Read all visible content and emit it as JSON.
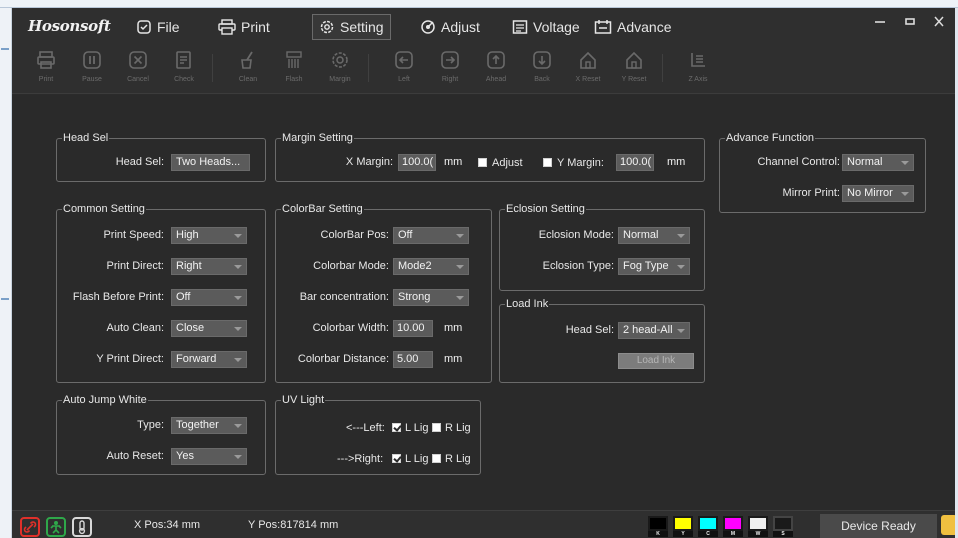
{
  "title_bar": {
    "logo": "Hosonsoft",
    "menu": [
      {
        "label": "File",
        "icon": "file-check-icon"
      },
      {
        "label": "Print",
        "icon": "printer-icon"
      },
      {
        "label": "Setting",
        "icon": "gear-icon",
        "active": true
      },
      {
        "label": "Adjust",
        "icon": "adjust-icon"
      },
      {
        "label": "Voltage",
        "icon": "voltage-icon"
      },
      {
        "label": "Advance",
        "icon": "advance-icon"
      }
    ]
  },
  "toolbar": {
    "buttons": [
      {
        "label": "Print",
        "icon": "print-icon"
      },
      {
        "label": "Pause",
        "icon": "pause-icon"
      },
      {
        "label": "Cancel",
        "icon": "cancel-icon"
      },
      {
        "label": "Check",
        "icon": "check-icon"
      },
      {
        "label": "Clean",
        "icon": "clean-icon"
      },
      {
        "label": "Flash",
        "icon": "flash-icon"
      },
      {
        "label": "Margin",
        "icon": "margin-icon"
      },
      {
        "label": "Left",
        "icon": "arrow-left-icon"
      },
      {
        "label": "Right",
        "icon": "arrow-right-icon"
      },
      {
        "label": "Ahead",
        "icon": "arrow-up-icon"
      },
      {
        "label": "Back",
        "icon": "arrow-down-icon"
      },
      {
        "label": "X Reset",
        "icon": "home-icon"
      },
      {
        "label": "Y Reset",
        "icon": "home-icon"
      },
      {
        "label": "Z Axis",
        "icon": "z-axis-icon"
      }
    ]
  },
  "head_sel_group": {
    "legend": "Head Sel",
    "label": "Head Sel:",
    "value": "Two Heads..."
  },
  "margin_group": {
    "legend": "Margin Setting",
    "x_label": "X Margin:",
    "x_value": "100.0(",
    "x_unit": "mm",
    "adjust_label": "Adjust",
    "y_label": "Y Margin:",
    "y_value": "100.0(",
    "y_unit": "mm"
  },
  "advance_group": {
    "legend": "Advance Function",
    "channel_label": "Channel Control:",
    "channel_value": "Normal",
    "mirror_label": "Mirror Print:",
    "mirror_value": "No Mirror"
  },
  "common_group": {
    "legend": "Common Setting",
    "rows": [
      {
        "label": "Print Speed:",
        "value": "High"
      },
      {
        "label": "Print Direct:",
        "value": "Right"
      },
      {
        "label": "Flash Before Print:",
        "value": "Off"
      },
      {
        "label": "Auto Clean:",
        "value": "Close"
      },
      {
        "label": "Y Print Direct:",
        "value": "Forward"
      }
    ]
  },
  "colorbar_group": {
    "legend": "ColorBar Setting",
    "pos_label": "ColorBar Pos:",
    "pos_value": "Off",
    "mode_label": "Colorbar Mode:",
    "mode_value": "Mode2",
    "conc_label": "Bar concentration:",
    "conc_value": "Strong",
    "width_label": "Colorbar Width:",
    "width_value": "10.00",
    "width_unit": "mm",
    "dist_label": "Colorbar Distance:",
    "dist_value": "5.00",
    "dist_unit": "mm"
  },
  "eclosion_group": {
    "legend": "Eclosion Setting",
    "mode_label": "Eclosion Mode:",
    "mode_value": "Normal",
    "type_label": "Eclosion Type:",
    "type_value": "Fog Type"
  },
  "load_ink_group": {
    "legend": "Load Ink",
    "head_label": "Head Sel:",
    "head_value": "2 head-All",
    "button": "Load Ink"
  },
  "auto_jump_group": {
    "legend": "Auto Jump White",
    "type_label": "Type:",
    "type_value": "Together",
    "reset_label": "Auto Reset:",
    "reset_value": "Yes"
  },
  "uv_group": {
    "legend": "UV Light",
    "left_label": "<---Left:",
    "right_label": "--->Right:",
    "l_lig": "L Lig",
    "r_lig": "R Lig"
  },
  "status": {
    "x_pos": "X Pos:34 mm",
    "y_pos": "Y Pos:817814 mm",
    "inks": [
      {
        "label": "K",
        "color": "#000000"
      },
      {
        "label": "Y",
        "color": "#ffff00"
      },
      {
        "label": "C",
        "color": "#00ffff"
      },
      {
        "label": "M",
        "color": "#ff00ff"
      },
      {
        "label": "W",
        "color": "#f0f0f0"
      },
      {
        "label": "S",
        "color": "#1a1a1a"
      }
    ],
    "device": "Device Ready"
  },
  "colors": {
    "accent_red": "#e0302a",
    "accent_green": "#2fa84a",
    "panel_bg": "#2a2a2a"
  }
}
